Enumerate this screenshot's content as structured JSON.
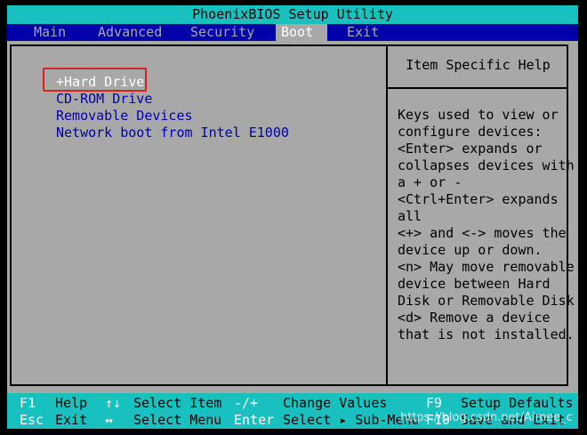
{
  "title": "PhoenixBIOS Setup Utility",
  "menu": [
    {
      "label": "Main",
      "active": false
    },
    {
      "label": "Advanced",
      "active": false
    },
    {
      "label": "Security",
      "active": false
    },
    {
      "label": "Boot",
      "active": true
    },
    {
      "label": "Exit",
      "active": false
    }
  ],
  "boot_items": [
    {
      "label": "+Hard Drive",
      "selected": true
    },
    {
      "label": "CD-ROM Drive",
      "selected": false
    },
    {
      "label": "Removable Devices",
      "selected": false
    },
    {
      "label": "Network boot from Intel E1000",
      "selected": false
    }
  ],
  "help": {
    "title": "Item Specific Help",
    "lines": [
      "Keys used to view or",
      "configure devices:",
      "<Enter> expands or",
      "collapses devices with",
      "a + or -",
      "<Ctrl+Enter> expands",
      "all",
      "<+> and <-> moves the",
      "device up or down.",
      "<n> May move removable",
      "device between Hard",
      "Disk or Removable Disk",
      "<d> Remove a device",
      "that is not installed."
    ]
  },
  "footer": {
    "row1": [
      {
        "key": "F1",
        "desc": "Help"
      },
      {
        "key": "↑↓",
        "desc": "Select Item"
      },
      {
        "key": "-/+",
        "desc": "Change Values"
      },
      {
        "key": "F9",
        "desc": "Setup Defaults"
      }
    ],
    "row2": [
      {
        "key": "Esc",
        "desc": "Exit"
      },
      {
        "key": "↔",
        "desc": "Select Menu"
      },
      {
        "key": "Enter",
        "desc": "Select ▸ Sub-Menu"
      },
      {
        "key": "F10",
        "desc": "Save and Exit"
      }
    ]
  },
  "watermark": "https://blog.csdn.net/Aimee_c",
  "colors": {
    "background": "#000000",
    "title_bar": "#19c0c0",
    "menu_bar": "#0000aa",
    "panel": "#a8a8a8",
    "item_text": "#0000aa",
    "highlight_box": "#e02020"
  }
}
